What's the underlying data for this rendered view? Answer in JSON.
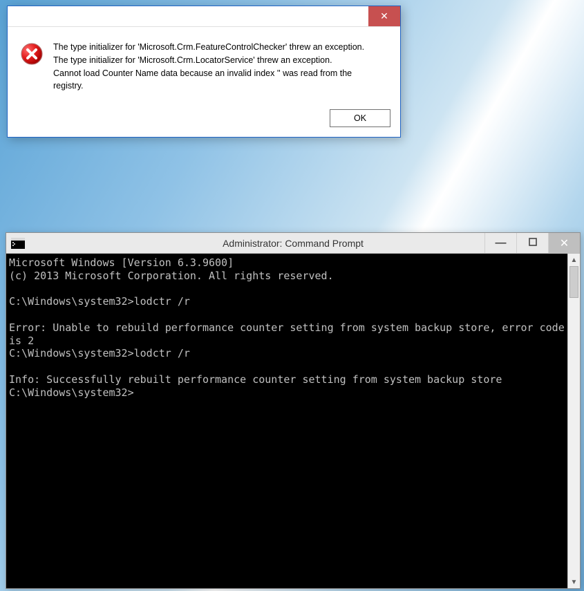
{
  "dialog": {
    "close_glyph": "✕",
    "message": "The type initializer for 'Microsoft.Crm.FeatureControlChecker' threw an exception.\nThe type initializer for 'Microsoft.Crm.LocatorService' threw an exception.\nCannot load Counter Name data because an invalid index '' was read from the registry.",
    "ok_label": "OK"
  },
  "cmd": {
    "title": "Administrator: Command Prompt",
    "minimize_glyph": "—",
    "maximize_glyph": "▢",
    "close_glyph": "✕",
    "scroll_up_glyph": "▲",
    "scroll_down_glyph": "▼",
    "output": "Microsoft Windows [Version 6.3.9600]\n(c) 2013 Microsoft Corporation. All rights reserved.\n\nC:\\Windows\\system32>lodctr /r\n\nError: Unable to rebuild performance counter setting from system backup store, error code is 2\nC:\\Windows\\system32>lodctr /r\n\nInfo: Successfully rebuilt performance counter setting from system backup store\nC:\\Windows\\system32>"
  }
}
